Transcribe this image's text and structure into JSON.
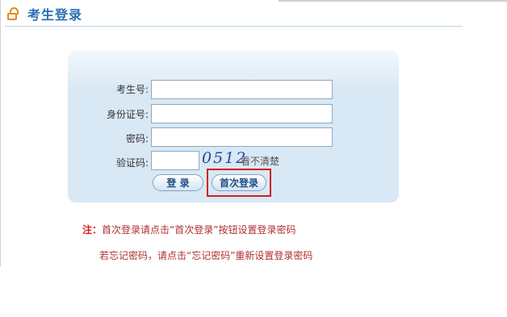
{
  "header": {
    "title": "考生登录",
    "icon": "lock-icon"
  },
  "form": {
    "exam_number_label": "考生号:",
    "exam_number_value": "",
    "id_number_label": "身份证号:",
    "id_number_value": "",
    "password_label": "密码:",
    "password_value": "",
    "captcha_label": "验证码:",
    "captcha_input_value": "",
    "captcha_text": "0512",
    "captcha_refresh_text": "看不清楚",
    "login_button": "登 录",
    "first_login_button": "首次登录"
  },
  "notes": {
    "prefix": "注：",
    "line1": "首次登录请点击“首次登录”按钮设置登录密码",
    "line2": "若忘记密码，请点击“忘记密码”重新设置登录密码"
  },
  "colors": {
    "title": "#2a6fb0",
    "panel": "#d9e8f5",
    "highlight": "#d21f1f",
    "note": "#b12f2f"
  }
}
